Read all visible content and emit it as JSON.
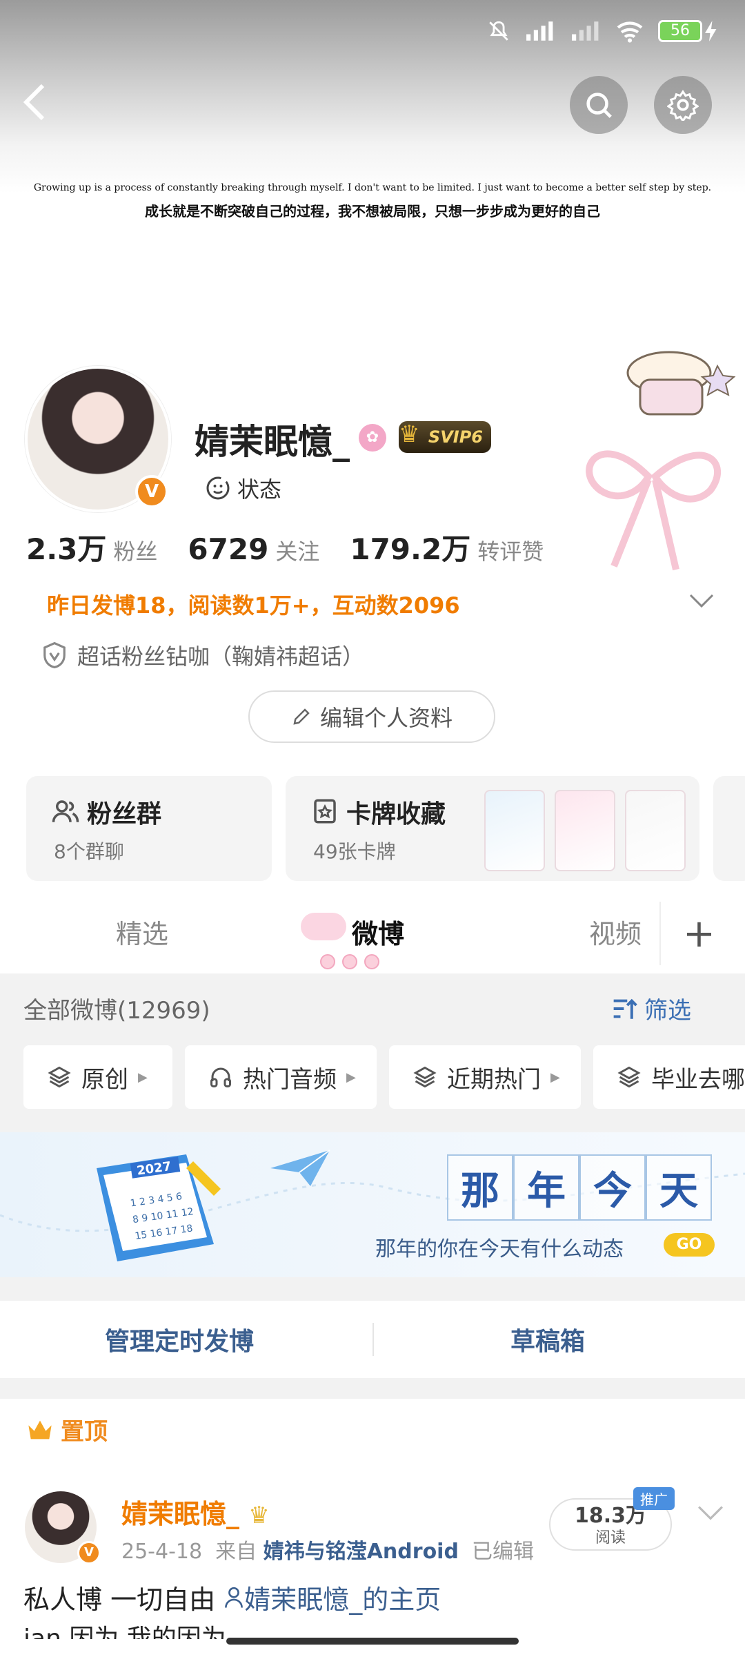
{
  "status_bar": {
    "battery": "56"
  },
  "header": {
    "motto_en": "Growing up is a process of constantly breaking through myself. I don't want to be limited. I just want to become a better self step by step.",
    "motto_zh": "成长就是不断突破自己的过程，我不想被局限，只想一步步成为更好的自己"
  },
  "profile": {
    "avatar_badge": "V",
    "username": "婧茉眠憶_",
    "svip_label": "SVIP6",
    "status_label": "状态",
    "stats": [
      {
        "value": "2.3万",
        "label": "粉丝"
      },
      {
        "value": "6729",
        "label": "关注"
      },
      {
        "value": "179.2万",
        "label": "转评赞"
      }
    ],
    "yesterday": "昨日发博18，阅读数1万+，互动数2096",
    "supertopic": "超话粉丝钻咖（鞠婧祎超话）",
    "edit_label": "编辑个人资料"
  },
  "cards": {
    "fans_group": {
      "title": "粉丝群",
      "sub": "8个群聊"
    },
    "card_collection": {
      "title": "卡牌收藏",
      "sub": "49张卡牌"
    }
  },
  "tabs": [
    "精选",
    "微博",
    "视频"
  ],
  "active_tab": "微博",
  "tab_plus": "+",
  "filter": {
    "all_label": "全部微博(12969)",
    "filter_label": "筛选",
    "chips": [
      "原创",
      "热门音频",
      "近期热门",
      "毕业去哪"
    ]
  },
  "that_year": {
    "chars": [
      "那",
      "年",
      "今",
      "天"
    ],
    "subtitle": "那年的你在今天有什么动态",
    "go": "GO",
    "calendar_year": "2027"
  },
  "manage": {
    "scheduled": "管理定时发博",
    "drafts": "草稿箱"
  },
  "pinned_label": "置顶",
  "post": {
    "author": "婧茉眠憶_",
    "avatar_badge": "V",
    "date": "25-4-18",
    "from_label": "来自",
    "source": "婧祎与铭滢Android",
    "edited": "已编辑",
    "reads_value": "18.3万",
    "reads_label": "阅读",
    "promo": "推广",
    "text_prefix": "私人博 一切自由",
    "text_link": "婧茉眠憶_的主页",
    "text_line2": "ian 因为 我的因为"
  },
  "colors": {
    "accent_orange": "#f07c00",
    "link_blue": "#3b5f8f",
    "vip_gold": "#f5d36c"
  }
}
